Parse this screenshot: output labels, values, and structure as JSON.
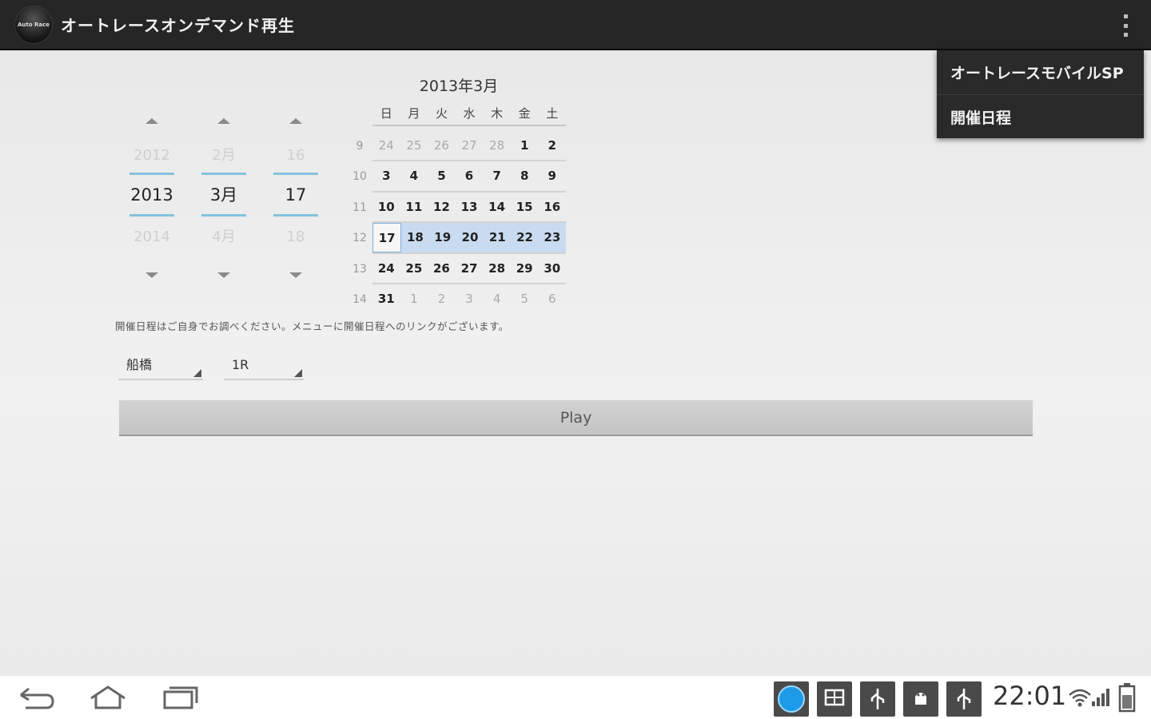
{
  "actionbar": {
    "logo_text": "Auto Race",
    "title": "オートレースオンデマンド再生"
  },
  "menu": {
    "items": [
      "オートレースモバイルSP",
      "開催日程"
    ]
  },
  "date_picker": {
    "year": {
      "prev": "2012",
      "current": "2013",
      "next": "2014"
    },
    "month": {
      "prev": "2月",
      "current": "3月",
      "next": "4月"
    },
    "day": {
      "prev": "16",
      "current": "17",
      "next": "18"
    }
  },
  "calendar": {
    "title": "2013年3月",
    "weekdays": [
      "日",
      "月",
      "火",
      "水",
      "木",
      "金",
      "土"
    ],
    "week_numbers": [
      "9",
      "10",
      "11",
      "12",
      "13",
      "14"
    ],
    "weeks": [
      [
        "24",
        "25",
        "26",
        "27",
        "28",
        "1",
        "2"
      ],
      [
        "3",
        "4",
        "5",
        "6",
        "7",
        "8",
        "9"
      ],
      [
        "10",
        "11",
        "12",
        "13",
        "14",
        "15",
        "16"
      ],
      [
        "17",
        "18",
        "19",
        "20",
        "21",
        "22",
        "23"
      ],
      [
        "24",
        "25",
        "26",
        "27",
        "28",
        "29",
        "30"
      ],
      [
        "31",
        "1",
        "2",
        "3",
        "4",
        "5",
        "6"
      ]
    ],
    "selected_date": "17"
  },
  "notice": "開催日程はご自身でお調べください。メニューに開催日程へのリンクがございます。",
  "venue_spinner": {
    "value": "船橋"
  },
  "race_spinner": {
    "value": "1R"
  },
  "play_button": {
    "label": "Play"
  },
  "statusbar": {
    "time": "22:01"
  },
  "colors": {
    "actionbar": "#262626",
    "picker_accent": "#84c2e0",
    "selected_week": "#c9dbf0",
    "play_button": "#c8c8c8"
  },
  "icons": [
    "back-icon",
    "home-icon",
    "recent-apps-icon",
    "browser-icon",
    "screenshot-icon",
    "usb-icon",
    "android-debug-icon",
    "usb-icon",
    "wifi-icon",
    "signal-icon",
    "battery-icon"
  ]
}
